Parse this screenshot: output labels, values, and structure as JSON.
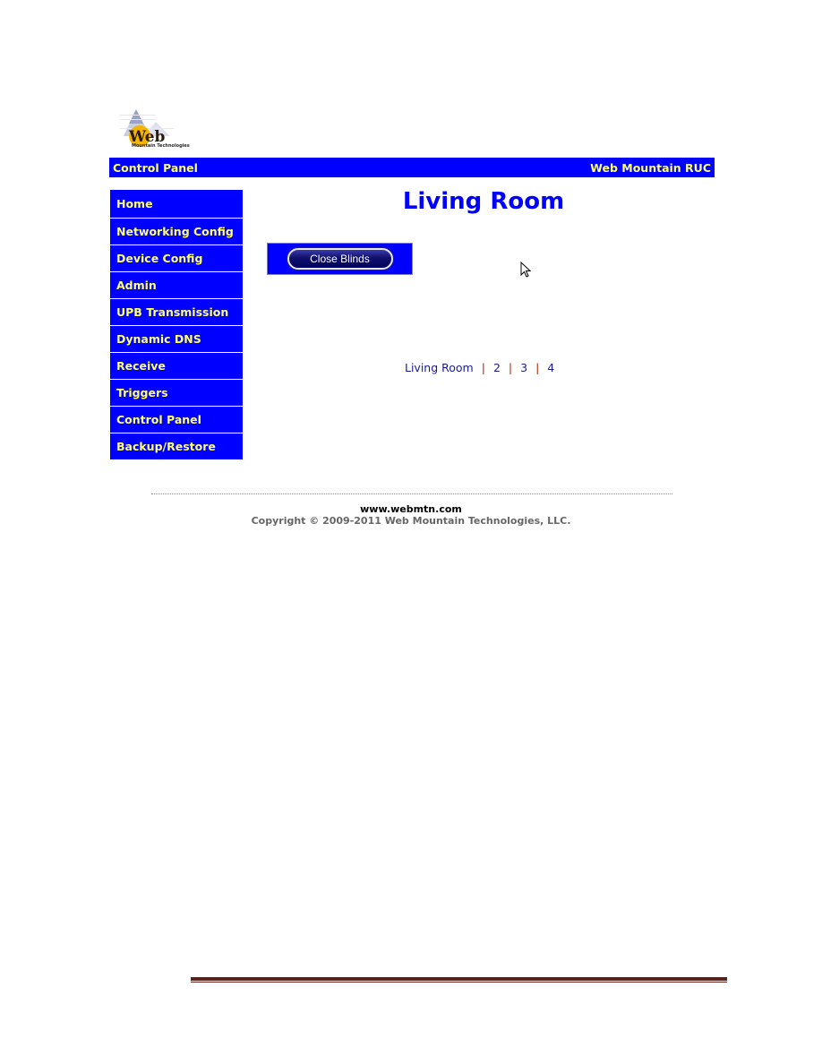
{
  "logo": {
    "text_main": "Web",
    "text_sub": "Mountain Technologies"
  },
  "topbar": {
    "left_title": "Control Panel",
    "right_title": "Web Mountain RUC"
  },
  "sidebar": {
    "items": [
      {
        "label": "Home"
      },
      {
        "label": "Networking Config"
      },
      {
        "label": "Device Config"
      },
      {
        "label": "Admin"
      },
      {
        "label": "UPB Transmission"
      },
      {
        "label": "Dynamic DNS"
      },
      {
        "label": "Receive"
      },
      {
        "label": "Triggers"
      },
      {
        "label": "Control Panel"
      },
      {
        "label": "Backup/Restore"
      }
    ]
  },
  "main": {
    "title": "Living Room",
    "action_button": "Close Blinds",
    "pager": {
      "links": [
        "Living Room",
        "2",
        "3",
        "4"
      ],
      "separator": "|"
    }
  },
  "footer": {
    "url": "www.webmtn.com",
    "copyright": "Copyright © 2009-2011 Web Mountain Technologies, LLC."
  },
  "colors": {
    "nav_bg": "#0000ff",
    "nav_text": "#ffff66",
    "title": "#0000ff",
    "rule": "#5c1f1a"
  }
}
